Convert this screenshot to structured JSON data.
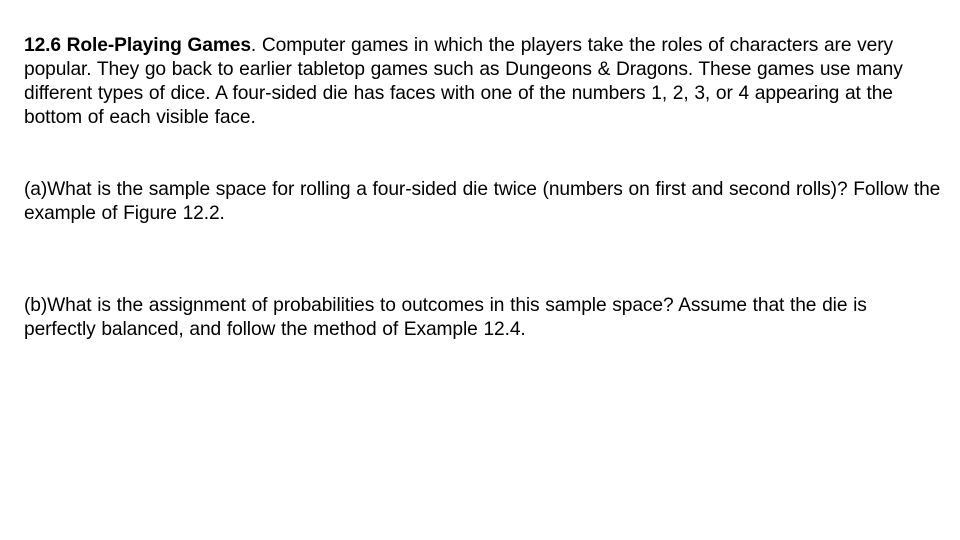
{
  "problem": {
    "number_title": "12.6 Role-Playing Games",
    "intro_text": ". Computer games in which the players take the roles of characters are very popular. They go back to earlier tabletop games such as Dungeons & Dragons. These games use many different types of dice. A four-sided die has faces with one of the numbers 1, 2, 3, or 4 appearing at the bottom of each visible face."
  },
  "questions": [
    {
      "label": "(a)",
      "text": "What is the sample space for rolling a four-sided die twice (numbers on first and second rolls)? Follow the example of Figure 12.2."
    },
    {
      "label": "(b)",
      "text": "What is the assignment of probabilities to outcomes in this sample space? Assume that the die is perfectly balanced, and follow the method of Example 12.4."
    }
  ]
}
